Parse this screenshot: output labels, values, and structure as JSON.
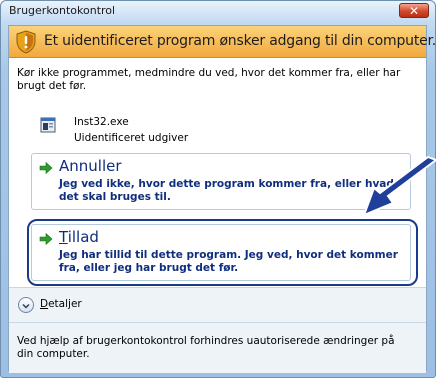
{
  "window": {
    "title": "Brugerkontokontrol",
    "close_label": "✕"
  },
  "banner": {
    "text": "Et uidentificeret program ønsker adgang til din computer."
  },
  "warning_text": "Kør ikke programmet, medmindre du ved, hvor det kommer fra, eller har brugt det før.",
  "program": {
    "name": "Inst32.exe",
    "publisher": "Uidentificeret udgiver"
  },
  "options": {
    "cancel": {
      "title": "Annuller",
      "description": "Jeg ved ikke, hvor dette program kommer fra, eller hvad det skal bruges til."
    },
    "allow": {
      "title_first_letter": "T",
      "title_rest": "illad",
      "description": "Jeg har tillid til dette program. Jeg ved, hvor det kommer fra, eller jeg har brugt det før."
    }
  },
  "details": {
    "label_first_letter": "D",
    "label_rest": "etaljer"
  },
  "footer_text": "Ved hjælp af brugerkontokontrol forhindres uautoriserede ændringer på din computer.",
  "colors": {
    "link_blue": "#102e7e",
    "banner_orange": "#f2a93c",
    "callout_arrow": "#1f3f9b",
    "option_arrow": "#2e9b2e"
  }
}
